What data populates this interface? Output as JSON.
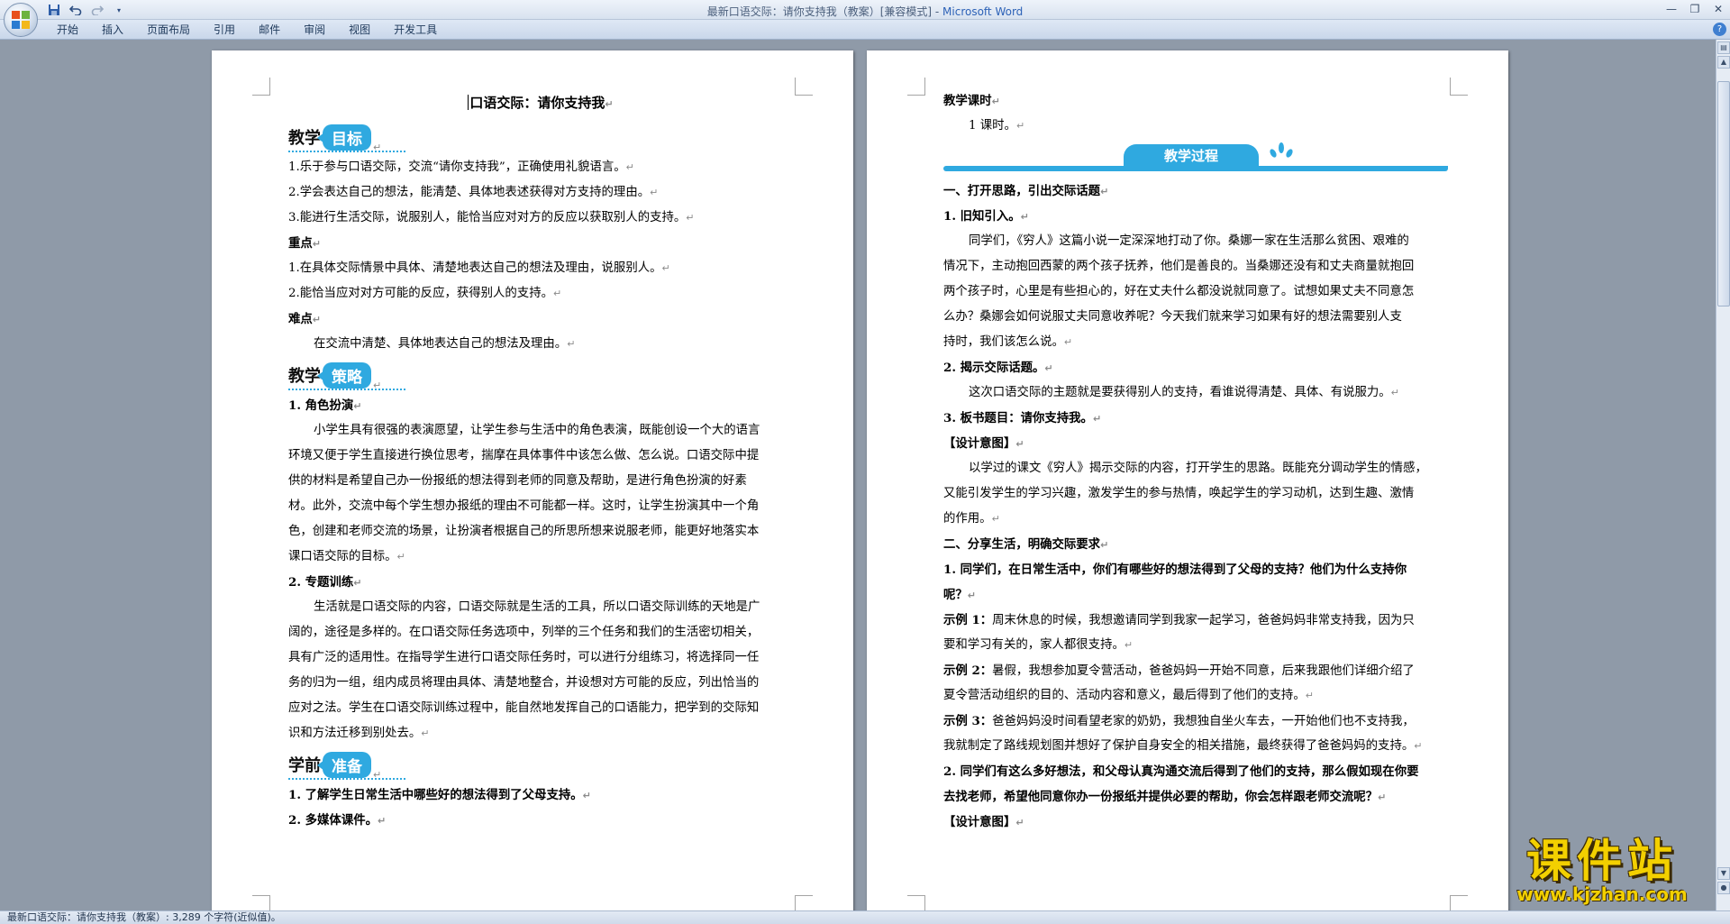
{
  "window": {
    "doc_name": "最新口语交际：请你支持我（教案）[兼容模式]",
    "separator": " - ",
    "app_name": "Microsoft Word"
  },
  "ribbon": {
    "tabs": [
      "开始",
      "插入",
      "页面布局",
      "引用",
      "邮件",
      "审阅",
      "视图",
      "开发工具"
    ]
  },
  "paragraph_mark": "↵",
  "page_left": {
    "title": "口语交际：请你支持我",
    "h1": {
      "a": "教学",
      "b": "目标"
    },
    "goals": [
      "1.乐于参与口语交际，交流“请你支持我”，正确使用礼貌语言。",
      "2.学会表达自己的想法，能清楚、具体地表述获得对方支持的理由。",
      "3.能进行生活交际，说服别人，能恰当应对对方的反应以获取别人的支持。"
    ],
    "key_label": "重点",
    "keys": [
      "1.在具体交际情景中具体、清楚地表达自己的想法及理由，说服别人。",
      "2.能恰当应对对方可能的反应，获得别人的支持。"
    ],
    "diff_label": "难点",
    "diff": "在交流中清楚、具体地表达自己的想法及理由。",
    "h2": {
      "a": "教学",
      "b": "策略"
    },
    "s1_title": "1. 角色扮演",
    "s1_lines": [
      "小学生具有很强的表演愿望，让学生参与生活中的角色表演，既能创设一个大的语言",
      "环境又便于学生直接进行换位思考，揣摩在具体事件中该怎么做、怎么说。口语交际中提",
      "供的材料是希望自己办一份报纸的想法得到老师的同意及帮助，是进行角色扮演的好素",
      "材。此外，交流中每个学生想办报纸的理由不可能都一样。这时，让学生扮演其中一个角",
      "色，创建和老师交流的场景，让扮演者根据自己的所思所想来说服老师，能更好地落实本",
      "课口语交际的目标。"
    ],
    "s2_title": "2. 专题训练",
    "s2_lines": [
      "生活就是口语交际的内容，口语交际就是生活的工具，所以口语交际训练的天地是广",
      "阔的，途径是多样的。在口语交际任务选项中，列举的三个任务和我们的生活密切相关，",
      "具有广泛的适用性。在指导学生进行口语交际任务时，可以进行分组练习，将选择同一任",
      "务的归为一组，组内成员将理由具体、清楚地整合，并设想对方可能的反应，列出恰当的",
      "应对之法。学生在口语交际训练过程中，能自然地发挥自己的口语能力，把学到的交际知",
      "识和方法迁移到别处去。"
    ],
    "h3": {
      "a": "学前",
      "b": "准备"
    },
    "prep": [
      "1. 了解学生日常生活中哪些好的想法得到了父母支持。",
      "2. 多媒体课件。"
    ]
  },
  "page_right": {
    "hours_label": "教学课时",
    "hours": "1 课时。",
    "banner": "教学过程",
    "p1": "一、打开思路，引出交际话题",
    "p1_1": "1. 旧知引入。",
    "p1_1_lines": [
      "同学们，《穷人》这篇小说一定深深地打动了你。桑娜一家在生活那么贫困、艰难的",
      "情况下，主动抱回西蒙的两个孩子抚养，他们是善良的。当桑娜还没有和丈夫商量就抱回",
      "两个孩子时，心里是有些担心的，好在丈夫什么都没说就同意了。试想如果丈夫不同意怎",
      "么办？桑娜会如何说服丈夫同意收养呢？今天我们就来学习如果有好的想法需要别人支",
      "持时，我们该怎么说。"
    ],
    "p1_2": "2. 揭示交际话题。",
    "p1_2_line": "这次口语交际的主题就是要获得别人的支持，看谁说得清楚、具体、有说服力。",
    "p1_3": "3. 板书题目：请你支持我。",
    "design1": "【设计意图】",
    "design1_lines": [
      "以学过的课文《穷人》揭示交际的内容，打开学生的思路。既能充分调动学生的情感，",
      "又能引发学生的学习兴趣，激发学生的参与热情，唤起学生的学习动机，达到生趣、激情",
      "的作用。"
    ],
    "p2": "二、分享生活，明确交际要求",
    "q1_lines": [
      "1. 同学们，在日常生活中，你们有哪些好的想法得到了父母的支持？他们为什么支持你",
      "呢？"
    ],
    "ex1_label": "示例 1：",
    "ex1_lines": [
      "周末休息的时候，我想邀请同学到我家一起学习，爸爸妈妈非常支持我，因为只",
      "要和学习有关的，家人都很支持。"
    ],
    "ex2_label": "示例 2：",
    "ex2_lines": [
      "暑假，我想参加夏令营活动，爸爸妈妈一开始不同意，后来我跟他们详细介绍了",
      "夏令营活动组织的目的、活动内容和意义，最后得到了他们的支持。"
    ],
    "ex3_label": "示例 3：",
    "ex3_lines": [
      "爸爸妈妈没时间看望老家的奶奶，我想独自坐火车去，一开始他们也不支持我，",
      "我就制定了路线规划图并想好了保护自身安全的相关措施，最终获得了爸爸妈妈的支持。"
    ],
    "q2_lines": [
      "2. 同学们有这么多好想法，和父母认真沟通交流后得到了他们的支持，那么假如现在你要",
      "去找老师，希望他同意你办一份报纸并提供必要的帮助，你会怎样跟老师交流呢？"
    ],
    "design2": "【设计意图】"
  },
  "status": "最新口语交际：请你支持我（教案）: 3,289 个字符(近似值)。",
  "watermark": {
    "main": "课件站",
    "url": "www.kjzhan.com"
  },
  "icons": {
    "office": "office-logo-icon",
    "save": "save-icon",
    "undo": "undo-icon",
    "redo": "redo-icon",
    "customize": "chevron-down-icon",
    "help": "help-icon"
  },
  "colors": {
    "accent": "#2fa9e0",
    "watermark": "#f3d000"
  }
}
